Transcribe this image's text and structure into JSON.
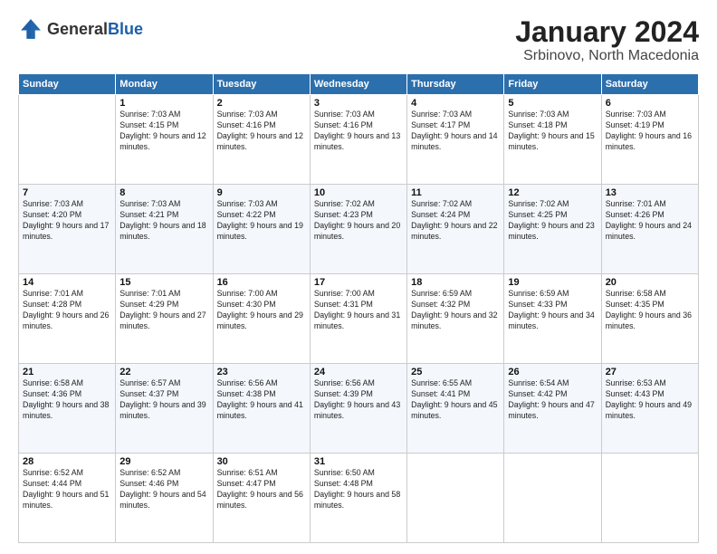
{
  "header": {
    "logo_general": "General",
    "logo_blue": "Blue",
    "title": "January 2024",
    "subtitle": "Srbinovo, North Macedonia"
  },
  "days_of_week": [
    "Sunday",
    "Monday",
    "Tuesday",
    "Wednesday",
    "Thursday",
    "Friday",
    "Saturday"
  ],
  "weeks": [
    [
      {
        "num": "",
        "sunrise": "",
        "sunset": "",
        "daylight": ""
      },
      {
        "num": "1",
        "sunrise": "Sunrise: 7:03 AM",
        "sunset": "Sunset: 4:15 PM",
        "daylight": "Daylight: 9 hours and 12 minutes."
      },
      {
        "num": "2",
        "sunrise": "Sunrise: 7:03 AM",
        "sunset": "Sunset: 4:16 PM",
        "daylight": "Daylight: 9 hours and 12 minutes."
      },
      {
        "num": "3",
        "sunrise": "Sunrise: 7:03 AM",
        "sunset": "Sunset: 4:16 PM",
        "daylight": "Daylight: 9 hours and 13 minutes."
      },
      {
        "num": "4",
        "sunrise": "Sunrise: 7:03 AM",
        "sunset": "Sunset: 4:17 PM",
        "daylight": "Daylight: 9 hours and 14 minutes."
      },
      {
        "num": "5",
        "sunrise": "Sunrise: 7:03 AM",
        "sunset": "Sunset: 4:18 PM",
        "daylight": "Daylight: 9 hours and 15 minutes."
      },
      {
        "num": "6",
        "sunrise": "Sunrise: 7:03 AM",
        "sunset": "Sunset: 4:19 PM",
        "daylight": "Daylight: 9 hours and 16 minutes."
      }
    ],
    [
      {
        "num": "7",
        "sunrise": "Sunrise: 7:03 AM",
        "sunset": "Sunset: 4:20 PM",
        "daylight": "Daylight: 9 hours and 17 minutes."
      },
      {
        "num": "8",
        "sunrise": "Sunrise: 7:03 AM",
        "sunset": "Sunset: 4:21 PM",
        "daylight": "Daylight: 9 hours and 18 minutes."
      },
      {
        "num": "9",
        "sunrise": "Sunrise: 7:03 AM",
        "sunset": "Sunset: 4:22 PM",
        "daylight": "Daylight: 9 hours and 19 minutes."
      },
      {
        "num": "10",
        "sunrise": "Sunrise: 7:02 AM",
        "sunset": "Sunset: 4:23 PM",
        "daylight": "Daylight: 9 hours and 20 minutes."
      },
      {
        "num": "11",
        "sunrise": "Sunrise: 7:02 AM",
        "sunset": "Sunset: 4:24 PM",
        "daylight": "Daylight: 9 hours and 22 minutes."
      },
      {
        "num": "12",
        "sunrise": "Sunrise: 7:02 AM",
        "sunset": "Sunset: 4:25 PM",
        "daylight": "Daylight: 9 hours and 23 minutes."
      },
      {
        "num": "13",
        "sunrise": "Sunrise: 7:01 AM",
        "sunset": "Sunset: 4:26 PM",
        "daylight": "Daylight: 9 hours and 24 minutes."
      }
    ],
    [
      {
        "num": "14",
        "sunrise": "Sunrise: 7:01 AM",
        "sunset": "Sunset: 4:28 PM",
        "daylight": "Daylight: 9 hours and 26 minutes."
      },
      {
        "num": "15",
        "sunrise": "Sunrise: 7:01 AM",
        "sunset": "Sunset: 4:29 PM",
        "daylight": "Daylight: 9 hours and 27 minutes."
      },
      {
        "num": "16",
        "sunrise": "Sunrise: 7:00 AM",
        "sunset": "Sunset: 4:30 PM",
        "daylight": "Daylight: 9 hours and 29 minutes."
      },
      {
        "num": "17",
        "sunrise": "Sunrise: 7:00 AM",
        "sunset": "Sunset: 4:31 PM",
        "daylight": "Daylight: 9 hours and 31 minutes."
      },
      {
        "num": "18",
        "sunrise": "Sunrise: 6:59 AM",
        "sunset": "Sunset: 4:32 PM",
        "daylight": "Daylight: 9 hours and 32 minutes."
      },
      {
        "num": "19",
        "sunrise": "Sunrise: 6:59 AM",
        "sunset": "Sunset: 4:33 PM",
        "daylight": "Daylight: 9 hours and 34 minutes."
      },
      {
        "num": "20",
        "sunrise": "Sunrise: 6:58 AM",
        "sunset": "Sunset: 4:35 PM",
        "daylight": "Daylight: 9 hours and 36 minutes."
      }
    ],
    [
      {
        "num": "21",
        "sunrise": "Sunrise: 6:58 AM",
        "sunset": "Sunset: 4:36 PM",
        "daylight": "Daylight: 9 hours and 38 minutes."
      },
      {
        "num": "22",
        "sunrise": "Sunrise: 6:57 AM",
        "sunset": "Sunset: 4:37 PM",
        "daylight": "Daylight: 9 hours and 39 minutes."
      },
      {
        "num": "23",
        "sunrise": "Sunrise: 6:56 AM",
        "sunset": "Sunset: 4:38 PM",
        "daylight": "Daylight: 9 hours and 41 minutes."
      },
      {
        "num": "24",
        "sunrise": "Sunrise: 6:56 AM",
        "sunset": "Sunset: 4:39 PM",
        "daylight": "Daylight: 9 hours and 43 minutes."
      },
      {
        "num": "25",
        "sunrise": "Sunrise: 6:55 AM",
        "sunset": "Sunset: 4:41 PM",
        "daylight": "Daylight: 9 hours and 45 minutes."
      },
      {
        "num": "26",
        "sunrise": "Sunrise: 6:54 AM",
        "sunset": "Sunset: 4:42 PM",
        "daylight": "Daylight: 9 hours and 47 minutes."
      },
      {
        "num": "27",
        "sunrise": "Sunrise: 6:53 AM",
        "sunset": "Sunset: 4:43 PM",
        "daylight": "Daylight: 9 hours and 49 minutes."
      }
    ],
    [
      {
        "num": "28",
        "sunrise": "Sunrise: 6:52 AM",
        "sunset": "Sunset: 4:44 PM",
        "daylight": "Daylight: 9 hours and 51 minutes."
      },
      {
        "num": "29",
        "sunrise": "Sunrise: 6:52 AM",
        "sunset": "Sunset: 4:46 PM",
        "daylight": "Daylight: 9 hours and 54 minutes."
      },
      {
        "num": "30",
        "sunrise": "Sunrise: 6:51 AM",
        "sunset": "Sunset: 4:47 PM",
        "daylight": "Daylight: 9 hours and 56 minutes."
      },
      {
        "num": "31",
        "sunrise": "Sunrise: 6:50 AM",
        "sunset": "Sunset: 4:48 PM",
        "daylight": "Daylight: 9 hours and 58 minutes."
      },
      {
        "num": "",
        "sunrise": "",
        "sunset": "",
        "daylight": ""
      },
      {
        "num": "",
        "sunrise": "",
        "sunset": "",
        "daylight": ""
      },
      {
        "num": "",
        "sunrise": "",
        "sunset": "",
        "daylight": ""
      }
    ]
  ]
}
